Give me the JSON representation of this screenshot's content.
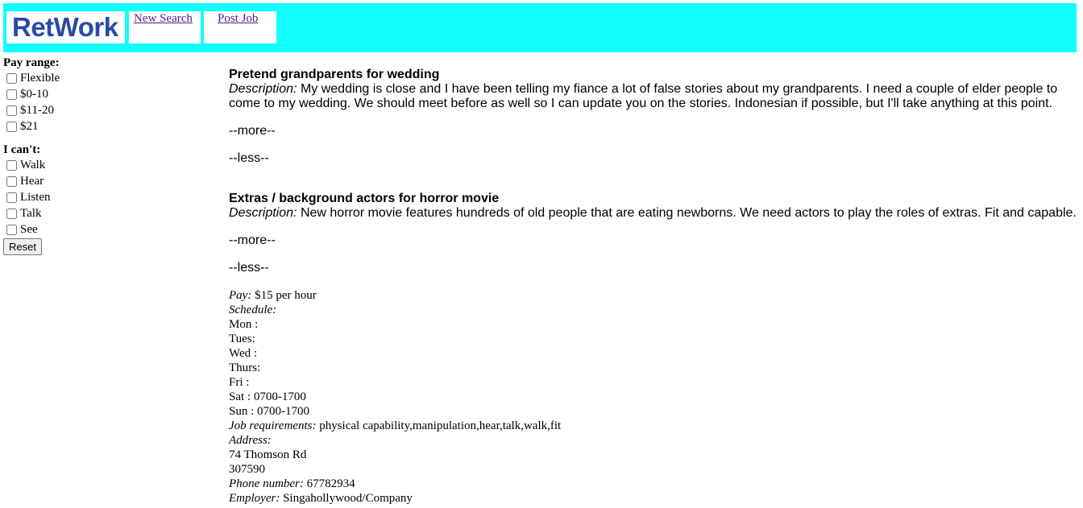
{
  "header": {
    "logo": "RetWork",
    "nav": [
      {
        "label": "New Search"
      },
      {
        "label": "Post Job"
      }
    ]
  },
  "filters": {
    "pay_range": {
      "title": "Pay range:",
      "options": [
        "Flexible",
        "$0-10",
        "$11-20",
        "$21"
      ]
    },
    "cant": {
      "title": "I can't:",
      "options": [
        "Walk",
        "Hear",
        "Listen",
        "Talk",
        "See"
      ]
    },
    "reset_label": "Reset"
  },
  "jobs": [
    {
      "title": "Pretend grandparents for wedding",
      "description_label": "Description:",
      "description": "My wedding is close and I have been telling my fiance a lot of false stories about my grandparents. I need a couple of elder people to come to my wedding. We should meet before as well so I can update you on the stories. Indonesian if possible, but I'll take anything at this point.",
      "more": "--more--",
      "less": "--less--"
    },
    {
      "title": "Extras / background actors for horror movie",
      "description_label": "Description:",
      "description": "New horror movie features hundreds of old people that are eating newborns. We need actors to play the roles of extras. Fit and capable.",
      "more": "--more--",
      "less": "--less--",
      "pay_label": "Pay:",
      "pay": "$15 per hour",
      "schedule_label": "Schedule:",
      "schedule": [
        "Mon :",
        "Tues:",
        "Wed :",
        "Thurs:",
        "Fri :",
        "Sat : 0700-1700",
        "Sun : 0700-1700"
      ],
      "requirements_label": "Job requirements:",
      "requirements": "physical capability,manipulation,hear,talk,walk,fit",
      "address_label": "Address:",
      "address": [
        "74 Thomson Rd",
        "307590"
      ],
      "phone_label": "Phone number:",
      "phone": "67782934",
      "employer_label": "Employer:",
      "employer": "Singahollywood/Company"
    }
  ]
}
